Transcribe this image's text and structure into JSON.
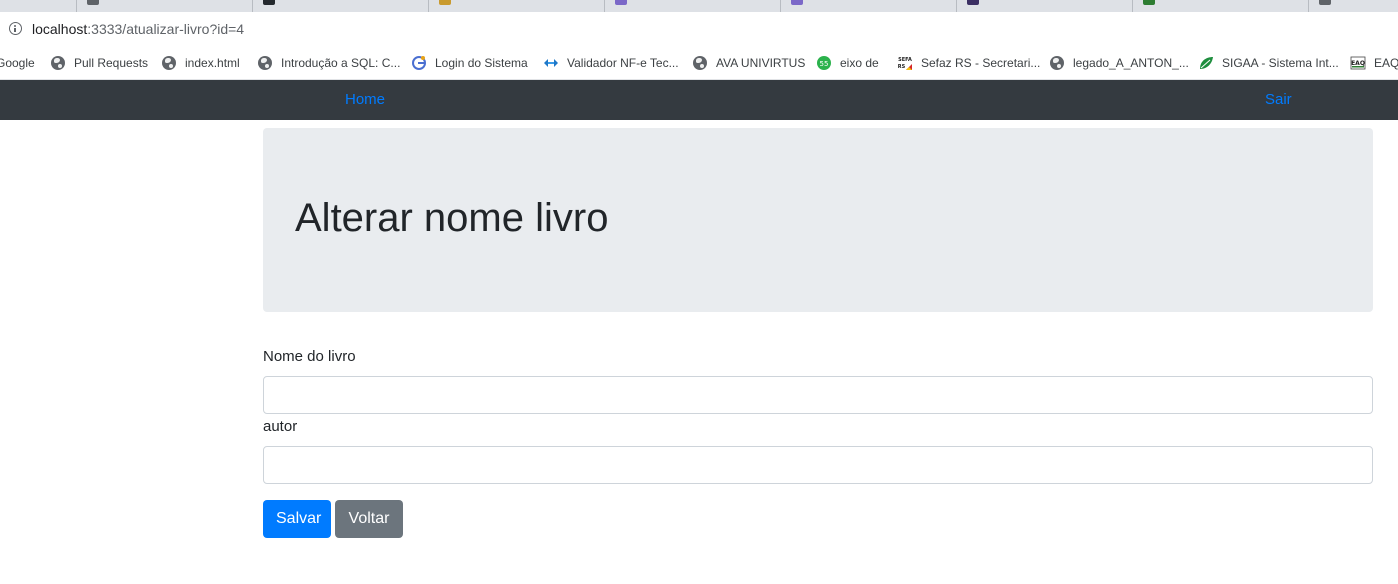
{
  "browser": {
    "url_host": "localhost",
    "url_rest": ":3333/atualizar-livro?id=4",
    "bookmarks": [
      {
        "label": "Google",
        "icon": "google-icon"
      },
      {
        "label": "Pull Requests",
        "icon": "globe-icon"
      },
      {
        "label": "index.html",
        "icon": "globe-icon"
      },
      {
        "label": "Introdução a SQL: C...",
        "icon": "globe-icon"
      },
      {
        "label": "Login do Sistema",
        "icon": "login-site-icon"
      },
      {
        "label": "Validador NF-e Tec...",
        "icon": "validator-icon"
      },
      {
        "label": "AVA UNIVIRTUS",
        "icon": "globe-icon"
      },
      {
        "label": "eixo de",
        "icon": "green-badge-icon"
      },
      {
        "label": "Sefaz RS - Secretari...",
        "icon": "sefaz-icon"
      },
      {
        "label": "legado_A_ANTON_...",
        "icon": "globe-icon"
      },
      {
        "label": "SIGAA - Sistema Int...",
        "icon": "leaf-icon"
      },
      {
        "label": "EAQ",
        "icon": "eaq-icon"
      }
    ]
  },
  "navbar": {
    "home": "Home",
    "logout": "Sair"
  },
  "page": {
    "title": "Alterar nome livro"
  },
  "form": {
    "book_name_label": "Nome do livro",
    "book_name_value": "",
    "author_label": "autor",
    "author_value": "",
    "save_button": "Salvar",
    "back_button": "Voltar"
  },
  "colors": {
    "navbar_bg": "#343a40",
    "link": "#007bff",
    "primary": "#007bff",
    "secondary": "#6c757d",
    "jumbotron_bg": "#e9ecef"
  }
}
